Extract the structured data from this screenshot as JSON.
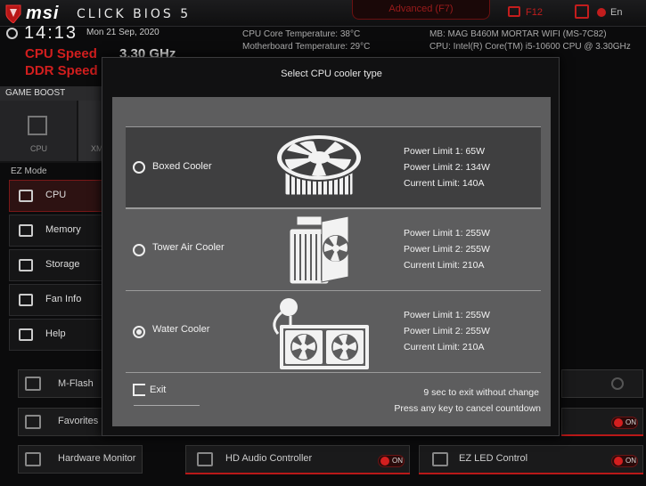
{
  "header": {
    "brand": "msi",
    "product": "CLICK BIOS 5",
    "advanced_tab": "Advanced (F7)",
    "screenshot_key": "F12",
    "language": "En"
  },
  "info": {
    "time": "14:13",
    "date": "Mon  21 Sep, 2020",
    "cpu_speed_label": "CPU Speed",
    "ddr_speed_label": "DDR Speed",
    "cpu_speed_value": "3.30 GHz",
    "cpu_core_temp": "CPU Core Temperature: 38°C",
    "mb_temp": "Motherboard Temperature: 29°C",
    "mb": "MB: MAG B460M MORTAR WIFI (MS-7C82)",
    "cpu": "CPU: Intel(R) Core(TM) i5-10600 CPU @ 3.30GHz"
  },
  "game_boost": {
    "label": "GAME BOOST",
    "tabs": [
      "CPU",
      "XM"
    ]
  },
  "ez_mode": {
    "title": "EZ Mode",
    "items": [
      {
        "label": "CPU",
        "icon": "cpu-icon",
        "selected": true
      },
      {
        "label": "Memory",
        "icon": "memory-icon",
        "selected": false
      },
      {
        "label": "Storage",
        "icon": "storage-icon",
        "selected": false
      },
      {
        "label": "Fan Info",
        "icon": "fan-icon",
        "selected": false
      },
      {
        "label": "Help",
        "icon": "help-icon",
        "selected": false
      }
    ]
  },
  "bottom": {
    "mflash": "M-Flash",
    "favorites": "Favorites",
    "hardware_monitor": "Hardware Monitor",
    "hd_audio": "HD Audio Controller",
    "ez_led": "EZ LED Control",
    "toggle": "ON"
  },
  "dialog": {
    "title": "Select CPU cooler type",
    "options": [
      {
        "label": "Boxed Cooler",
        "selected": false,
        "pl1": "Power Limit 1: 65W",
        "pl2": "Power Limit 2: 134W",
        "current": "Current Limit: 140A"
      },
      {
        "label": "Tower Air Cooler",
        "selected": false,
        "pl1": "Power Limit 1: 255W",
        "pl2": "Power Limit 2: 255W",
        "current": "Current Limit: 210A"
      },
      {
        "label": "Water Cooler",
        "selected": true,
        "pl1": "Power Limit 1: 255W",
        "pl2": "Power Limit 2: 255W",
        "current": "Current Limit: 210A"
      }
    ],
    "exit": "Exit",
    "countdown": "9  sec to exit without change",
    "cancel_hint": "Press any key to cancel countdown"
  },
  "colors": {
    "accent": "#d11e1e",
    "panel": "#5d5d5e",
    "selected_row": "#3f3f40"
  }
}
